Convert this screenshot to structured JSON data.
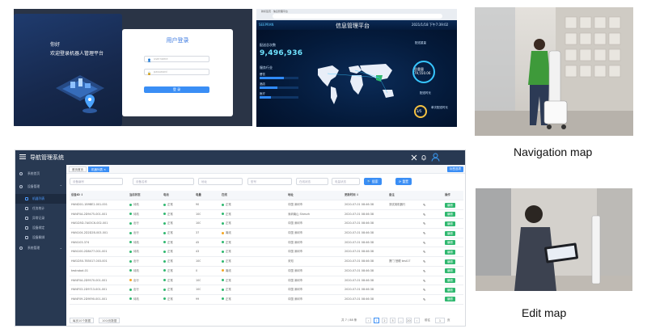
{
  "login": {
    "greeting": "你好",
    "welcome": "欢迎登录机器人管理平台",
    "card_title": "用户登录",
    "username_placeholder": "username",
    "password_placeholder": "password",
    "login_button": "登 录"
  },
  "dashboard": {
    "browser_tabs": "新标签页 · 信息管理平台",
    "brand": "SEEPRAN",
    "title": "信息管理平台",
    "datetime": "2021/1/18 下午7:39:02",
    "total_label": "配送总次数",
    "total_value": "9,496,936",
    "industry_label": "服务行业",
    "bars": [
      {
        "label": "餐饮",
        "value": 0.62
      },
      {
        "label": "酒店",
        "value": 0.45
      },
      {
        "label": "医疗",
        "value": 0.3
      }
    ],
    "rate_label": "配送重量",
    "ring1_label": "总重量",
    "ring1_value": "79,550.06",
    "ring2_label": "配送时长",
    "ring2_value": "3/5",
    "legend_label": "单次配送时长"
  },
  "photos": {
    "nav_caption": "Navigation map",
    "edit_caption": "Edit map"
  },
  "app": {
    "title": "导航管理系统",
    "sidebar": [
      {
        "label": "系统首页",
        "sub": false,
        "active": false
      },
      {
        "label": "设备管理",
        "sub": false,
        "active": false,
        "caret": "⌃"
      },
      {
        "label": "机器列表",
        "sub": true,
        "active": true
      },
      {
        "label": "任务统计",
        "sub": true,
        "active": false
      },
      {
        "label": "异常记录",
        "sub": true,
        "active": false
      },
      {
        "label": "设备绑定",
        "sub": true,
        "active": false
      },
      {
        "label": "设备解绑",
        "sub": true,
        "active": false
      },
      {
        "label": "系统管理",
        "sub": false,
        "active": false,
        "caret": "⌄"
      }
    ],
    "tabs": [
      "首页首页",
      "机器列表 ✕"
    ],
    "tab_right": "标签选项",
    "filters": [
      "设备编号",
      "设备名称",
      "地址",
      "型号",
      "在线状态",
      "电量状态"
    ],
    "search_button": "🔍 搜索",
    "reset_button": "⟳ 重置",
    "columns": [
      "设备ID ↕",
      "当前状态",
      "电池",
      "电量",
      "在线",
      "地址",
      "更新时间 ↕",
      "备注",
      "",
      "操作"
    ],
    "rows": [
      {
        "id": "HW4D01-1B9BE2-001-001",
        "status": "待机",
        "sc": "#2fb86f",
        "bat": "正常",
        "level": "90",
        "online": "正常",
        "addr": "中国 深圳市",
        "time": "2020-07-01 08:46:38",
        "note": "测试用机器行",
        "op": "编辑"
      },
      {
        "id": "HW4F0A-2D9475-001-001",
        "status": "待机",
        "sc": "#2fb86f",
        "bat": "正常",
        "level": "100",
        "online": "正常",
        "addr": "深圳南山 Shenzh",
        "time": "2020-07-01 08:46:38",
        "note": "",
        "op": "编辑"
      },
      {
        "id": "HW1D5D-7A03C6-002-001",
        "status": "出行",
        "sc": "#2fb86f",
        "bat": "正常",
        "level": "100",
        "online": "正常",
        "addr": "中国 深圳市",
        "time": "2020-07-01 08:46:38",
        "note": "",
        "op": "编辑"
      },
      {
        "id": "HW4104-2D2D2B-003-001",
        "status": "出行",
        "sc": "#2fb86f",
        "bat": "正常",
        "level": "37",
        "online": "离线",
        "addr": "中国 深圳市",
        "time": "2020-07-01 08:46:38",
        "note": "",
        "op": "编辑"
      },
      {
        "id": "HW4103-374",
        "status": "待机",
        "sc": "#2fb86f",
        "bat": "正常",
        "level": "45",
        "online": "正常",
        "addr": "中国 深圳市",
        "time": "2020-07-01 08:46:38",
        "note": "",
        "op": "编辑"
      },
      {
        "id": "HW4100-2D8477-001-001",
        "status": "待机",
        "sc": "#2fb86f",
        "bat": "正常",
        "level": "43",
        "online": "正常",
        "addr": "中国 深圳市",
        "time": "2020-07-01 08:46:38",
        "note": "",
        "op": "编辑"
      },
      {
        "id": "HW1D50-7B5017-003-001",
        "status": "出行",
        "sc": "#2fb86f",
        "bat": "正常",
        "level": "100",
        "online": "正常",
        "addr": "未知",
        "time": "2020-07-01 08:46:38",
        "note": "厦门 慧眼 test17",
        "op": "编辑"
      },
      {
        "id": "testrobot-01",
        "status": "待机",
        "sc": "#2fb86f",
        "bat": "正常",
        "level": "0",
        "online": "离线",
        "addr": "中国 深圳市",
        "time": "2020-07-01 08:46:38",
        "note": "",
        "op": "编辑"
      },
      {
        "id": "HW4F0A-2D9570-001-001",
        "status": "出行",
        "sc": "#f5a623",
        "bat": "正常",
        "level": "100",
        "online": "正常",
        "addr": "中国 深圳市",
        "time": "2020-07-01 08:46:38",
        "note": "",
        "op": "编辑"
      },
      {
        "id": "HW4F03-2D9713-001-001",
        "status": "出行",
        "sc": "#2fb86f",
        "bat": "正常",
        "level": "100",
        "online": "正常",
        "addr": "中国 深圳市",
        "time": "2020-07-01 08:46:38",
        "note": "",
        "op": "编辑"
      },
      {
        "id": "HW4F09-2D9E90-001-001",
        "status": "待机",
        "sc": "#2fb86f",
        "bat": "正常",
        "level": "99",
        "online": "正常",
        "addr": "中国 深圳市",
        "time": "2020-07-01 08:46:38",
        "note": "",
        "op": "编辑"
      }
    ],
    "pager": {
      "page_size": "每页10个数据",
      "sort": "100/页数据",
      "total": "共 7 / 88 条",
      "pages": [
        "‹",
        "1",
        "2",
        "3",
        "…",
        "20",
        "›"
      ],
      "goto_label": "前往",
      "goto_value": "1",
      "goto_suffix": "页"
    }
  },
  "colors": {
    "accent": "#3a8ef5",
    "sidebar": "#283952",
    "success": "#2fb86f"
  }
}
